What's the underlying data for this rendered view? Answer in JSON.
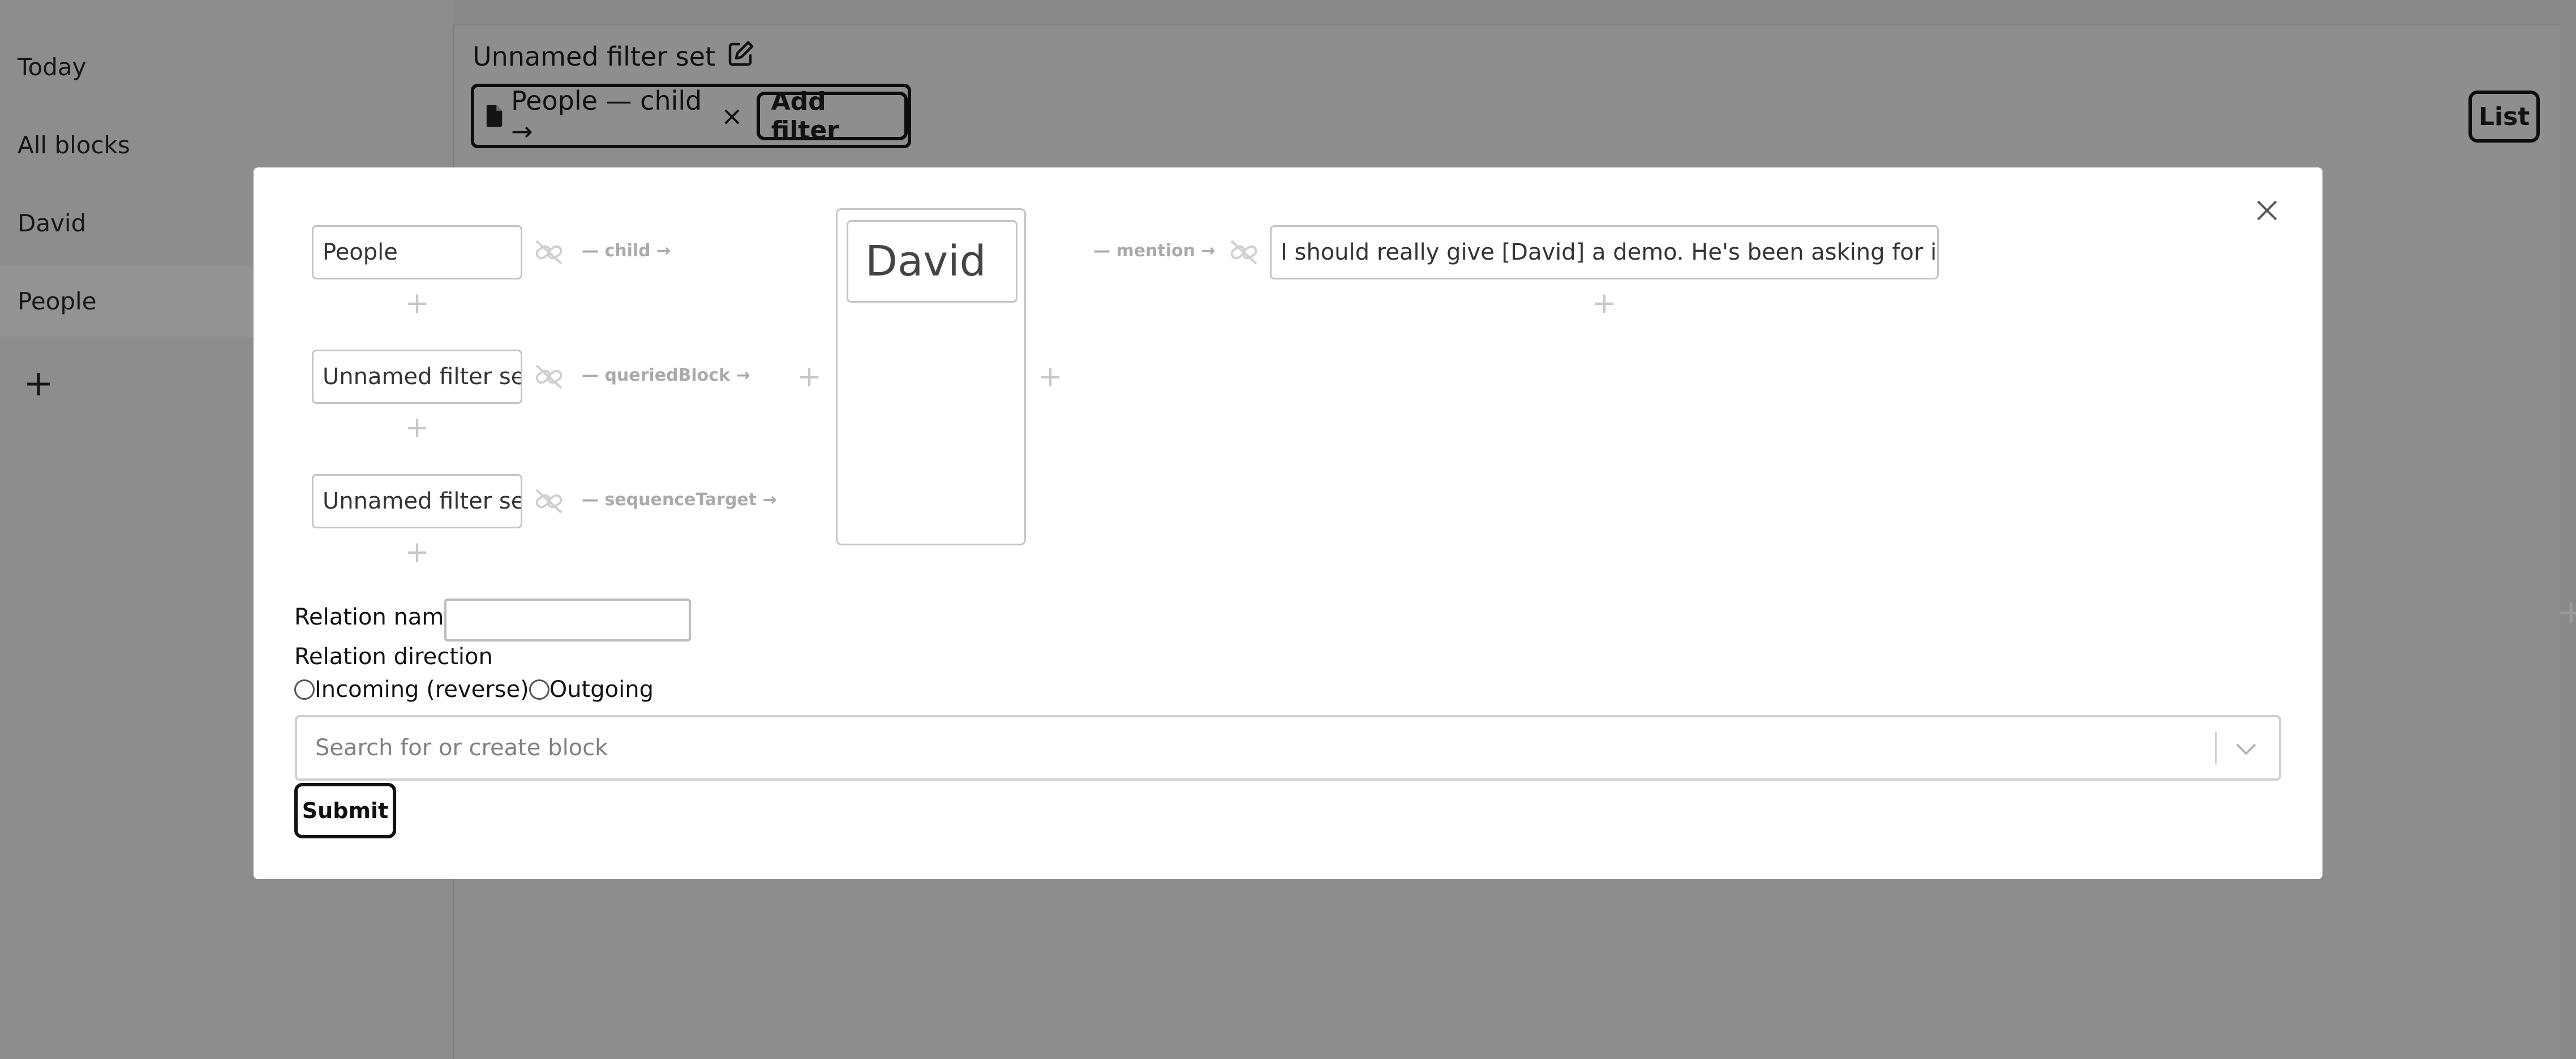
{
  "sidebar": {
    "items": [
      {
        "label": "Today"
      },
      {
        "label": "All blocks"
      },
      {
        "label": "David"
      },
      {
        "label": "People"
      }
    ],
    "add_icon": "plus-icon"
  },
  "main": {
    "filter_set_title": "Unnamed filter set",
    "edit_icon": "edit-icon",
    "filter_chip": {
      "icon": "document-icon",
      "label": "People — child →",
      "remove_glyph": "×"
    },
    "add_filter_label": "Add filter",
    "view_mode_label": "List"
  },
  "modal": {
    "close_icon": "close-icon",
    "left_nodes": [
      {
        "label": "People",
        "relation": "— child →"
      },
      {
        "label": "Unnamed filter set",
        "relation": "— queriedBlock →"
      },
      {
        "label": "Unnamed filter set",
        "relation": "— sequenceTarget →"
      }
    ],
    "center_node": {
      "label": "David"
    },
    "right_relation": "— mention →",
    "right_node": {
      "label": "I should really give [David] a demo. He's been asking for it since"
    },
    "form": {
      "relation_name_label": "Relation name",
      "relation_name_value": "",
      "relation_direction_label": "Relation direction",
      "direction_options": [
        "Incoming (reverse)",
        "Outgoing"
      ],
      "search_placeholder": "Search for or create block",
      "submit_label": "Submit"
    }
  }
}
